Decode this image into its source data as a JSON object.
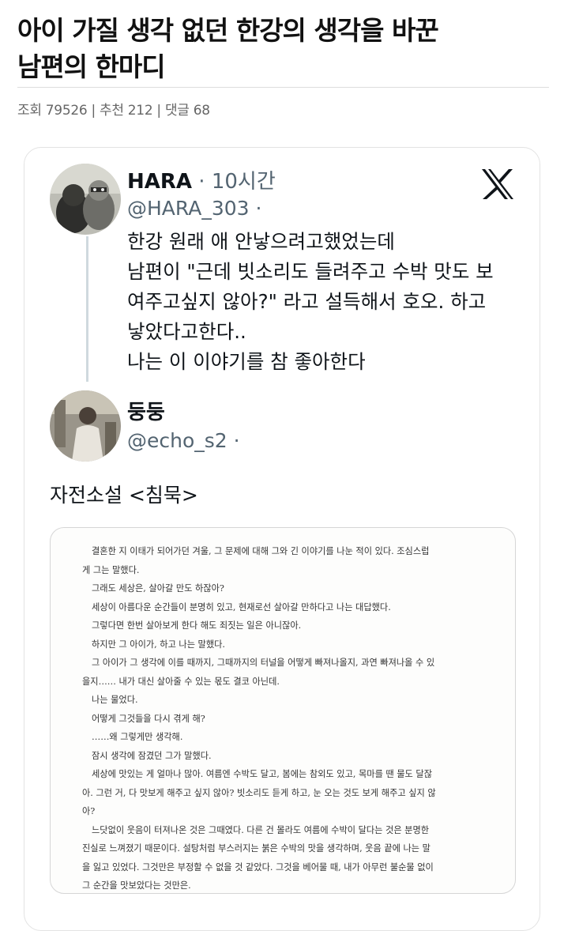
{
  "post": {
    "title_line1": "아이 가질 생각 없던 한강의 생각을 바꾼",
    "title_line2": "남편의 한마디",
    "meta": "조회 79526 | 추천 212 | 댓글 68"
  },
  "tweet": {
    "logo_icon": "x-logo-icon",
    "author_name": "HARA",
    "time": "· 10시간",
    "handle": "@HARA_303 ·",
    "text_lines": [
      "한강 원래 애 안낳으려고했었는데",
      "남편이 \"근데 빗소리도 들려주고 수박 맛도 보",
      "여주고싶지 않아?\" 라고 설득해서 호오. 하고",
      "낳았다고한다..",
      "나는 이 이야기를 참 좋아한다"
    ]
  },
  "reply": {
    "author_name": "둥둥",
    "handle": "@echo_s2 ·",
    "text": "자전소설 <침묵>"
  },
  "book_excerpt": {
    "lines": [
      "결혼한 지 이태가 되어가던 겨울, 그 문제에 대해 그와 긴 이야기를 나눈 적이 있다. 조심스럽",
      "게 그는 말했다.",
      "그래도 세상은, 살아갈 만도 하잖아?",
      "세상이 아름다운 순간들이 분명히 있고, 현재로선 살아갈 만하다고 나는 대답했다.",
      "그렇다면 한번 살아보게 한다 해도 죄짓는 일은 아니잖아.",
      "하지만 그 아이가, 하고 나는 말했다.",
      "그 아이가 그 생각에 이를 때까지, 그때까지의 터널을 어떻게 빠져나올지, 과연 빠져나올 수 있",
      "을지…… 내가 대신 살아줄 수 있는 몫도 결코 아닌데.",
      "나는 물었다.",
      "어떻게 그것들을 다시 겪게 해?",
      "……왜 그렇게만 생각해.",
      "잠시 생각에 잠겼던 그가 말했다.",
      "세상에 맛있는 게 얼마나 많아. 여름엔 수박도 달고, 봄에는 참외도 있고, 목마를 땐 물도 달잖",
      "아. 그런 거, 다 맛보게 해주고 싶지 않아? 빗소리도 듣게 하고, 눈 오는 것도 보게 해주고 싶지 않",
      "아?",
      "느닷없이 웃음이 터져나온 것은 그때였다. 다른 건 몰라도 여름에 수박이 달다는 것은 분명한",
      "진실로 느껴졌기 때문이다. 설탕처럼 부스러지는 붉은 수박의 맛을 생각하며, 웃음 끝에 나는 말",
      "을 잃고 있었다. 그것만은 부정할 수 없을 것 같았다. 그것을 베어물 때, 내가 아무런 불순물 없이",
      "그 순간을 맛보았다는 것만은."
    ],
    "indented": [
      true,
      false,
      true,
      true,
      true,
      true,
      true,
      false,
      true,
      true,
      true,
      true,
      true,
      false,
      false,
      true,
      false,
      false,
      false
    ]
  }
}
